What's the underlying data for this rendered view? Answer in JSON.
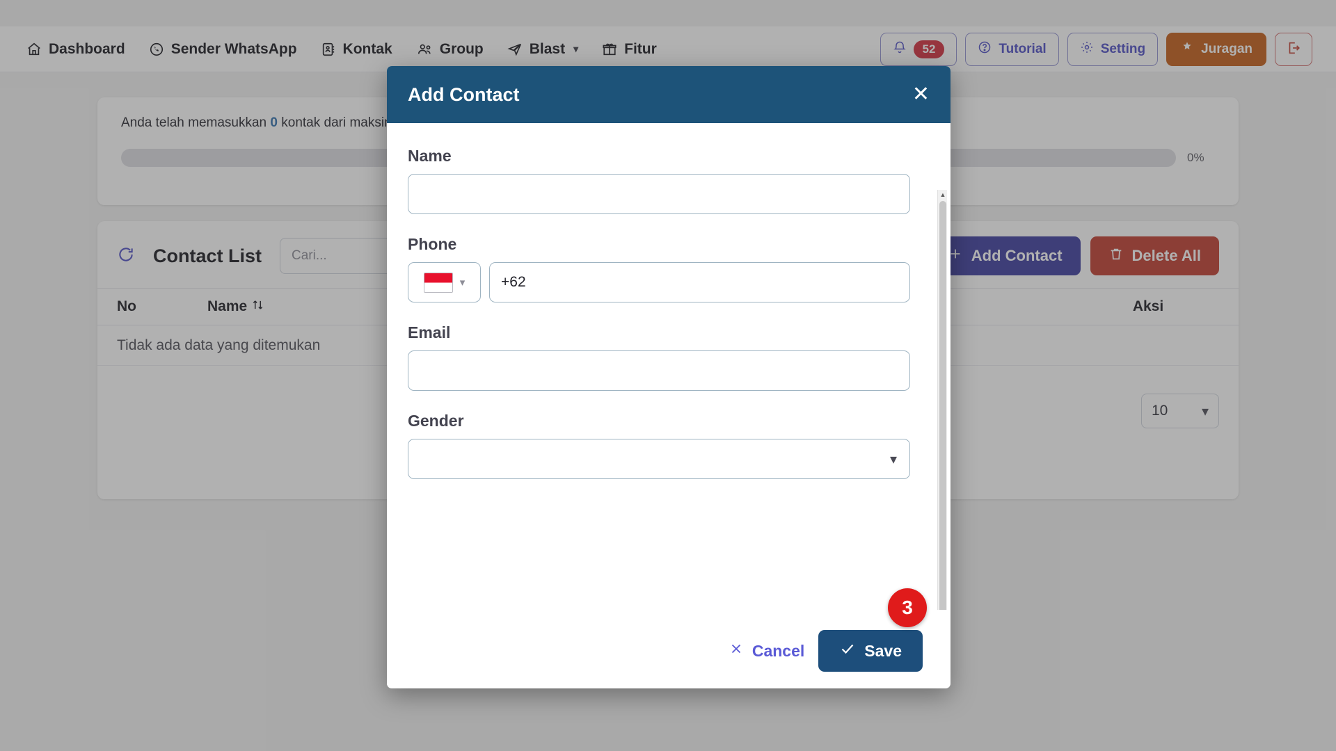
{
  "navbar": {
    "items": [
      {
        "label": "Dashboard",
        "icon": "home-icon",
        "caret": false
      },
      {
        "label": "Sender WhatsApp",
        "icon": "whatsapp-icon",
        "caret": false
      },
      {
        "label": "Kontak",
        "icon": "contact-card-icon",
        "caret": false
      },
      {
        "label": "Group",
        "icon": "users-icon",
        "caret": false
      },
      {
        "label": "Blast",
        "icon": "send-icon",
        "caret": true
      },
      {
        "label": "Fitur",
        "icon": "gift-icon",
        "caret": false
      }
    ],
    "notifications": {
      "icon": "bell-icon",
      "count": "52"
    },
    "tutorial": {
      "label": "Tutorial",
      "icon": "question-circle-icon"
    },
    "setting": {
      "label": "Setting",
      "icon": "gear-icon"
    },
    "juragan": {
      "label": "Juragan",
      "icon": "star-icon"
    },
    "logout": {
      "icon": "logout-icon"
    },
    "accent_purple": "#4b4bc4",
    "accent_orange": "#c35a13"
  },
  "quota": {
    "text_before": "Anda telah memasukkan ",
    "count": "0",
    "text_after": " kontak dari maksimal",
    "percent_label": "0%",
    "progress_value": 0
  },
  "contact_list": {
    "refresh_icon": "refresh-icon",
    "title": "Contact List",
    "search_placeholder": "Cari...",
    "search_value": "",
    "add_button": "Add Contact",
    "delete_button": "Delete All",
    "columns": [
      "No",
      "Name",
      "Aksi"
    ],
    "sort_icon": "sort-arrows-icon",
    "empty_message": "Tidak ada data yang ditemukan",
    "page_size": "10"
  },
  "modal": {
    "title": "Add Contact",
    "close_icon": "close-icon",
    "fields": {
      "name": {
        "label": "Name",
        "value": "",
        "placeholder": ""
      },
      "phone": {
        "label": "Phone",
        "country_flag": "indonesia-flag-icon",
        "country_caret": "chevron-down-icon",
        "value": "+62",
        "placeholder": ""
      },
      "email": {
        "label": "Email",
        "value": "",
        "placeholder": ""
      },
      "gender": {
        "label": "Gender",
        "value": "",
        "caret": "chevron-down-icon"
      }
    },
    "cancel_label": "Cancel",
    "save_label": "Save",
    "step_badge": "3",
    "header_color": "#1d5379",
    "save_color": "#1d4e7b",
    "badge_color": "#e01b1b"
  }
}
